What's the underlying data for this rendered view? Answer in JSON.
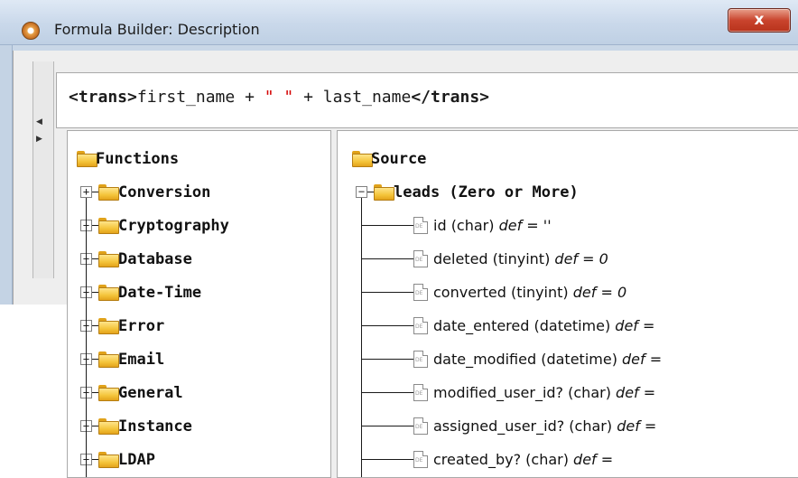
{
  "window": {
    "title": "Formula Builder: Description",
    "close_label": "x"
  },
  "expression": {
    "open_tag": "<trans>",
    "part1": "first_name + ",
    "string_literal": "\" \"",
    "part2": " + last_name",
    "close_tag": "</trans>"
  },
  "functions": {
    "root_label": "Functions",
    "items": [
      {
        "label": "Conversion"
      },
      {
        "label": "Cryptography"
      },
      {
        "label": "Database"
      },
      {
        "label": "Date-Time"
      },
      {
        "label": "Error"
      },
      {
        "label": "Email"
      },
      {
        "label": "General"
      },
      {
        "label": "Instance"
      },
      {
        "label": "LDAP"
      }
    ]
  },
  "source": {
    "root_label": "Source",
    "table_label": "leads (Zero or More)",
    "fields": [
      {
        "name": "id (char) ",
        "def": "def = ''"
      },
      {
        "name": "deleted (tinyint) ",
        "def": "def = 0"
      },
      {
        "name": "converted (tinyint) ",
        "def": "def = 0"
      },
      {
        "name": "date_entered (datetime) ",
        "def": "def ="
      },
      {
        "name": "date_modified (datetime) ",
        "def": "def ="
      },
      {
        "name": "modified_user_id? (char) ",
        "def": "def ="
      },
      {
        "name": "assigned_user_id? (char) ",
        "def": "def ="
      },
      {
        "name": "created_by? (char) ",
        "def": "def ="
      }
    ]
  },
  "icons": {
    "app": "formula-builder-app-icon",
    "folder": "folder-icon",
    "field": "field-doc-icon",
    "expand": "plus-expander-icon",
    "collapse": "minus-expander-icon"
  }
}
